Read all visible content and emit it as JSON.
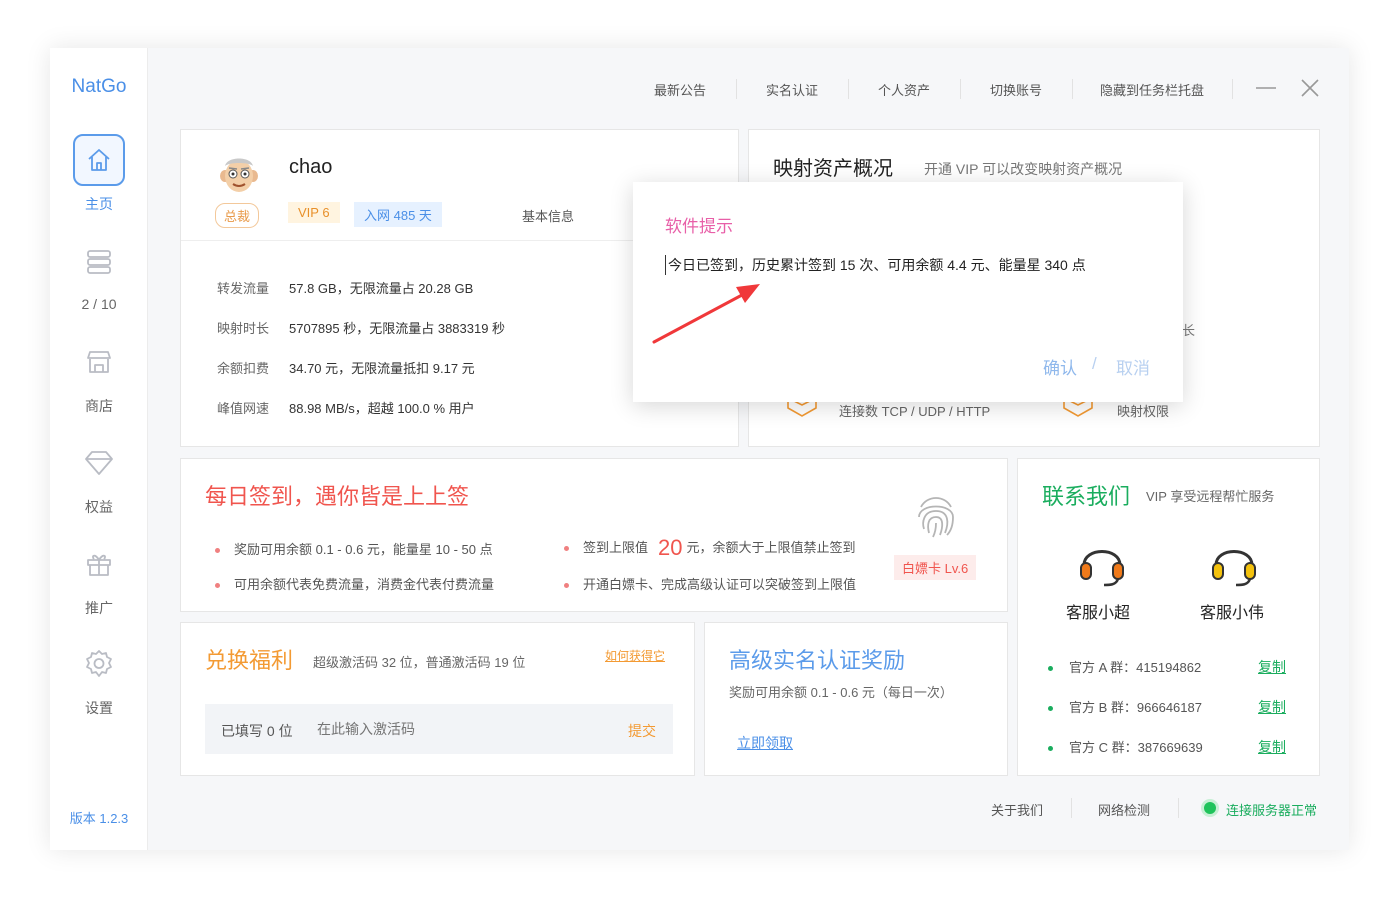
{
  "app": {
    "logo": "NatGo",
    "version": "版本 1.2.3"
  },
  "sidebar": {
    "items": [
      {
        "label": "主页",
        "icon": "home-icon"
      },
      {
        "label": "2 / 10",
        "icon": "server-icon"
      },
      {
        "label": "商店",
        "icon": "store-icon"
      },
      {
        "label": "权益",
        "icon": "diamond-icon"
      },
      {
        "label": "推广",
        "icon": "gift-icon"
      },
      {
        "label": "设置",
        "icon": "gear-icon"
      }
    ]
  },
  "topbar": {
    "links": [
      "最新公告",
      "实名认证",
      "个人资产",
      "切换账号",
      "隐藏到任务栏托盘"
    ]
  },
  "profile": {
    "username": "chao",
    "role_badge": "总裁",
    "vip_badge": "VIP 6",
    "days_badge": "入网 485 天",
    "basic_info": "基本信息",
    "stats": [
      {
        "label": "转发流量",
        "value": "57.8 GB，无限流量占 20.28 GB"
      },
      {
        "label": "映射时长",
        "value": "5707895 秒，无限流量占 3883319 秒"
      },
      {
        "label": "余额扣费",
        "value": "34.70 元，无限流量抵扣 9.17 元"
      },
      {
        "label": "峰值网速",
        "value": "88.98 MB/s，超越 100.0 % 用户"
      }
    ]
  },
  "assets": {
    "title": "映射资产概况",
    "subtitle": "开通 VIP 可以改变映射资产概况",
    "partial_text": "长",
    "item_connections": "连接数 TCP / UDP / HTTP",
    "item_permissions": "映射权限"
  },
  "checkin": {
    "title": "每日签到，遇你皆是上上签",
    "bullet1": "奖励可用余额 0.1 - 0.6 元，能量星 10 - 50 点",
    "bullet2": "可用余额代表免费流量，消费金代表付费流量",
    "bullet3_prefix": "签到上限值",
    "bullet3_num": "20",
    "bullet3_suffix": "元，余额大于上限值禁止签到",
    "bullet4": "开通白嫖卡、完成高级认证可以突破签到上限值",
    "card_badge": "白嫖卡 Lv.6"
  },
  "contact": {
    "title": "联系我们",
    "subtitle": "VIP 享受远程帮忙服务",
    "agent1": "客服小超",
    "agent2": "客服小伟",
    "groups": [
      {
        "label": "官方 A 群：415194862",
        "action": "复制"
      },
      {
        "label": "官方 B 群：966646187",
        "action": "复制"
      },
      {
        "label": "官方 C 群：387669639",
        "action": "复制"
      }
    ],
    "color_agent1": "#f07a1a",
    "color_agent2": "#f4c20d"
  },
  "redeem": {
    "title": "兑换福利",
    "subtitle": "超级激活码 32 位，普通激活码 19 位",
    "help_link": "如何获得它",
    "filled": "已填写 0 位",
    "placeholder": "在此输入激活码",
    "submit": "提交"
  },
  "realname": {
    "title": "高级实名认证奖励",
    "subtitle": "奖励可用余额 0.1 - 0.6 元（每日一次）",
    "action": "立即领取"
  },
  "footer": {
    "about": "关于我们",
    "network": "网络检测",
    "status": "连接服务器正常"
  },
  "dialog": {
    "title": "软件提示",
    "message": "今日已签到，历史累计签到 15 次、可用余额 4.4 元、能量星 340 点",
    "confirm": "确认",
    "separator": "/",
    "cancel": "取消"
  },
  "colors": {
    "accent_blue": "#4a8fe7",
    "checkin_red": "#f0554e",
    "redeem_orange": "#f39a33",
    "contact_green": "#1aad5e",
    "dialog_title_pink": "#e85fa8",
    "arrow_red": "#f0383a"
  }
}
